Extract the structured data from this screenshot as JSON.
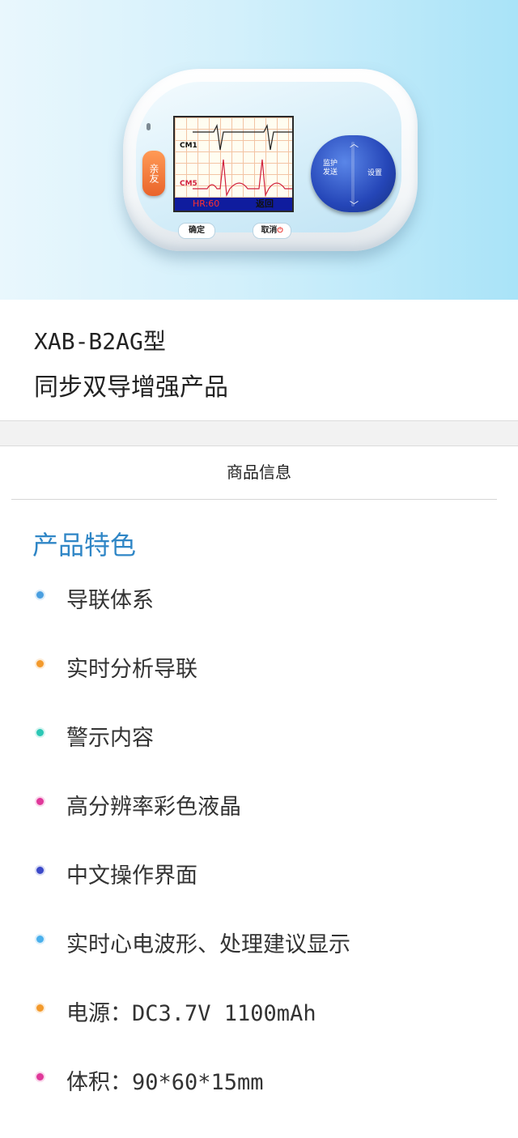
{
  "device": {
    "side_button": "亲友",
    "screen": {
      "lead1": "CM1",
      "lead2": "CM5",
      "hr": "HR:60",
      "back": "返回"
    },
    "pad": {
      "monitor": "监护\n发送",
      "set": "设置",
      "up": "︿",
      "down": "﹀"
    },
    "confirm_button": "确定",
    "cancel_button": "取消"
  },
  "product": {
    "model": "XAB-B2AG型",
    "subtitle": "同步双导增强产品"
  },
  "section": {
    "heading": "商品信息",
    "feature_title": "产品特色"
  },
  "features": [
    {
      "text": "导联体系",
      "color": "#4a9fe0"
    },
    {
      "text": "实时分析导联",
      "color": "#f39a2c"
    },
    {
      "text": "警示内容",
      "color": "#2cc7b5"
    },
    {
      "text": "高分辨率彩色液晶",
      "color": "#e0389a"
    },
    {
      "text": "中文操作界面",
      "color": "#3b49c9"
    },
    {
      "text": "实时心电波形、处理建议显示",
      "color": "#4ab0ec"
    },
    {
      "text": "电源：DC3.7V  1100mAh",
      "color": "#f39a2c"
    },
    {
      "text": "体积：90*60*15mm",
      "color": "#e0389a"
    }
  ]
}
